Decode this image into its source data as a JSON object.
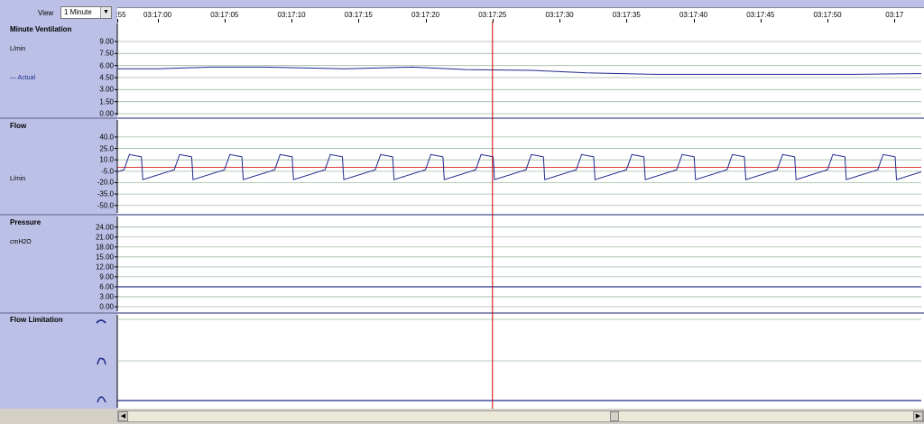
{
  "toolbar": {
    "view_label": "View",
    "view_value": "1 Minute"
  },
  "time_axis": {
    "labels": [
      ":55",
      "03:17:00",
      "03:17:05",
      "03:17:10",
      "03:17:15",
      "03:17:20",
      "03:17:25",
      "03:17:30",
      "03:17:35",
      "03:17:40",
      "03:17:45",
      "03:17:50",
      "03:17"
    ],
    "cursor_time": "03:17:25"
  },
  "colors": {
    "panel_bg": "#bcc0e6",
    "trace": "#1d2a8c",
    "cursor": "#cc0000",
    "grid": "#9fb99f"
  },
  "chart_data": [
    {
      "type": "line",
      "title": "Minute Ventilation",
      "ylabel": "L/min",
      "yticks": [
        "9.00",
        "7.50",
        "6.00",
        "4.50",
        "3.00",
        "1.50",
        "0.00"
      ],
      "ylim": [
        0,
        9.9
      ],
      "series": [
        {
          "name": "Actual",
          "x": [
            0,
            3,
            7,
            11,
            17,
            22,
            26,
            31,
            35,
            40,
            45,
            50,
            55,
            60
          ],
          "values": [
            5.6,
            5.6,
            5.8,
            5.8,
            5.6,
            5.8,
            5.5,
            5.4,
            5.1,
            4.9,
            4.9,
            4.9,
            4.9,
            5.0
          ]
        }
      ]
    },
    {
      "type": "line",
      "title": "Flow",
      "ylabel": "L/min",
      "yticks": [
        "40.0",
        "25.0",
        "10.0",
        "-5.0",
        "-20.0",
        "-35.0",
        "-50.0"
      ],
      "ylim": [
        -55,
        47
      ],
      "reference_line": 0,
      "breath_period_s": 3.75,
      "breath_start_s": 0.5,
      "series": [
        {
          "name": "",
          "pattern": {
            "inspiratory_peak": 17,
            "plateau": 14,
            "expiratory_start": -16,
            "expiratory_end": -3
          }
        }
      ]
    },
    {
      "type": "line",
      "title": "Pressure",
      "ylabel": "cmH2O",
      "yticks": [
        "24.00",
        "21.00",
        "18.00",
        "15.00",
        "12.00",
        "9.00",
        "6.00",
        "3.00",
        "0.00"
      ],
      "ylim": [
        0,
        25
      ],
      "series": [
        {
          "name": "",
          "x": [
            0,
            60
          ],
          "values": [
            6.0,
            6.0
          ]
        }
      ]
    },
    {
      "type": "line",
      "title": "Flow Limitation",
      "ylabel": "",
      "yticks": [],
      "ylim": [
        0,
        1
      ],
      "series": [
        {
          "name": "",
          "x": [
            0,
            60
          ],
          "values": [
            0,
            0
          ]
        }
      ]
    }
  ]
}
